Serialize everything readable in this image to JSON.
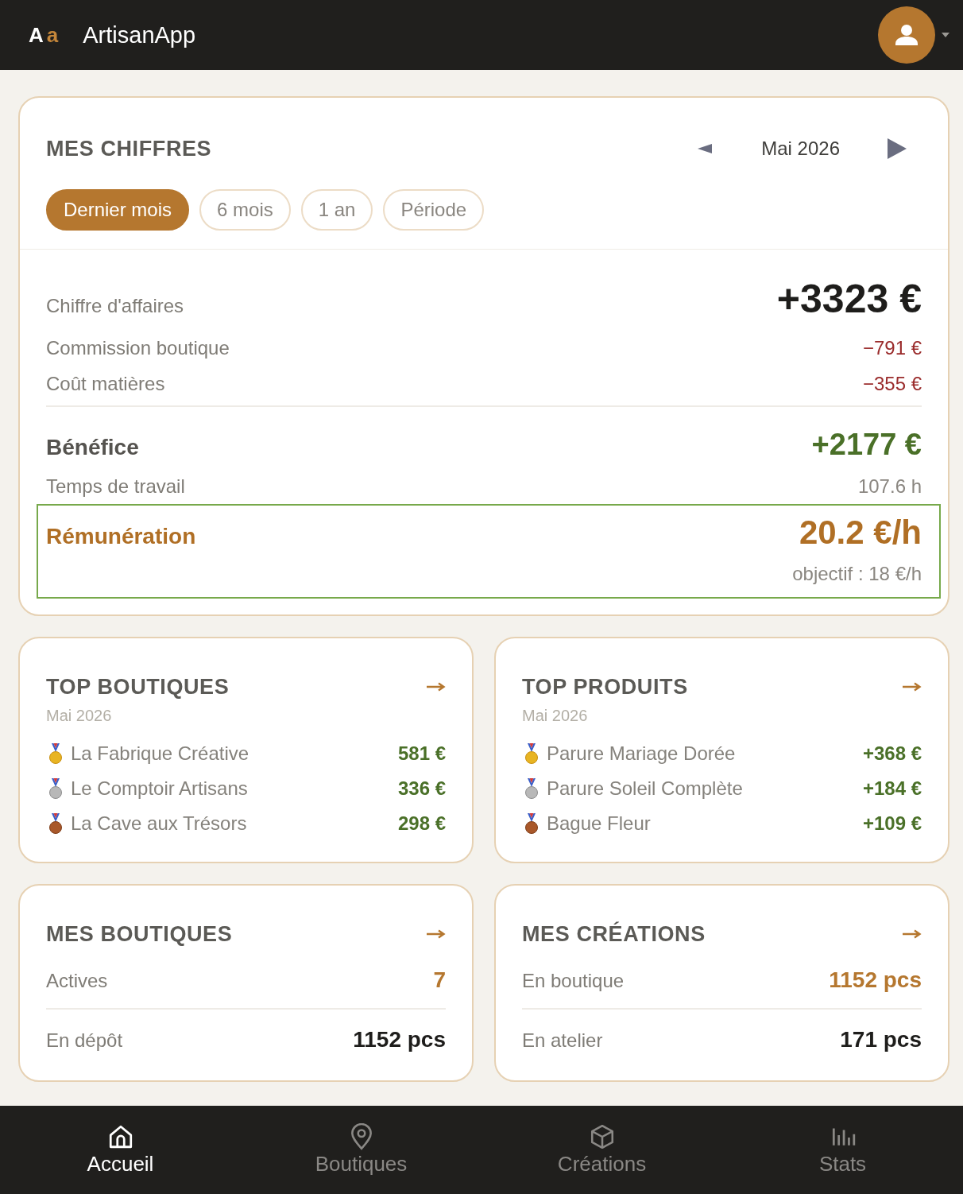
{
  "header": {
    "logo": [
      "A",
      "a"
    ],
    "app_name": "ArtisanApp"
  },
  "figures": {
    "title": "MES CHIFFRES",
    "month": "Mai 2026",
    "periods": [
      {
        "label": "Dernier mois",
        "selected": true
      },
      {
        "label": "6 mois",
        "selected": false
      },
      {
        "label": "1 an",
        "selected": false
      },
      {
        "label": "Période",
        "selected": false
      }
    ],
    "breakdown": [
      {
        "kind": "total",
        "label": "Chiffre d'affaires",
        "value": "+3323 €"
      },
      {
        "kind": "cost",
        "label": "Commission boutique",
        "value": "−791 €"
      },
      {
        "kind": "cost",
        "label": "Coût matières",
        "value": "−355 €"
      }
    ],
    "profit": {
      "label": "Bénéfice",
      "value": "+2177 €"
    },
    "work_time": {
      "label": "Temps de travail",
      "value": "107.6 h"
    },
    "hourly_rate": {
      "label": "Rémunération",
      "value": "20.2 €/h",
      "target": "objectif : 18 €/h",
      "goal_met": true
    }
  },
  "top_lists": [
    {
      "title": "TOP BOUTIQUES",
      "subtitle": "Mai 2026",
      "items": [
        {
          "name": "La Fabrique Créative",
          "value": "581 €"
        },
        {
          "name": "Le Comptoir Artisans",
          "value": "336 €"
        },
        {
          "name": "La Cave aux Trésors",
          "value": "298 €"
        }
      ]
    },
    {
      "title": "TOP PRODUITS",
      "subtitle": "Mai 2026",
      "items": [
        {
          "name": "Parure Mariage Dorée",
          "value": "+368 €"
        },
        {
          "name": "Parure Soleil Complète",
          "value": "+184 €"
        },
        {
          "name": "Bague Fleur",
          "value": "+109 €"
        }
      ]
    }
  ],
  "summaries": [
    {
      "title": "MES BOUTIQUES",
      "rows": [
        {
          "label": "Actives",
          "value": "7",
          "highlight": true
        },
        {
          "label": "En dépôt",
          "value": "1152 pcs",
          "highlight": false
        }
      ]
    },
    {
      "title": "MES CRÉATIONS",
      "rows": [
        {
          "label": "En boutique",
          "value": "1152 pcs",
          "highlight": true
        },
        {
          "label": "En atelier",
          "value": "171 pcs",
          "highlight": false
        }
      ]
    }
  ],
  "bottom_nav": [
    {
      "label": "Accueil",
      "selected": true
    },
    {
      "label": "Boutiques",
      "selected": false
    },
    {
      "label": "Créations",
      "selected": false
    },
    {
      "label": "Stats",
      "selected": false
    }
  ]
}
